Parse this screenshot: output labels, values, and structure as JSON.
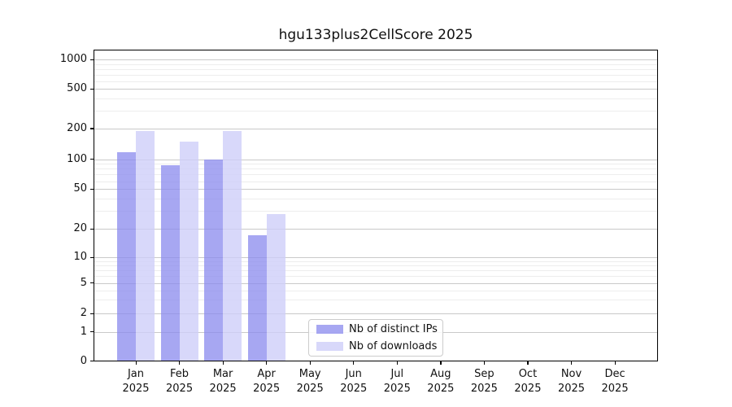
{
  "chart_data": {
    "type": "bar",
    "title": "hgu133plus2CellScore 2025",
    "categories": [
      "Jan 2025",
      "Feb 2025",
      "Mar 2025",
      "Apr 2025",
      "May 2025",
      "Jun 2025",
      "Jul 2025",
      "Aug 2025",
      "Sep 2025",
      "Oct 2025",
      "Nov 2025",
      "Dec 2025"
    ],
    "series": [
      {
        "name": "Nb of distinct IPs",
        "color": "rgba(137,137,238,0.75)",
        "color_on_white": "#a6a6f2",
        "values": [
          118,
          87,
          100,
          17,
          0,
          0,
          0,
          0,
          0,
          0,
          0,
          0
        ]
      },
      {
        "name": "Nb of downloads",
        "color": "rgba(206,206,249,0.8)",
        "color_on_white": "#d9d9f8",
        "values": [
          190,
          150,
          190,
          28,
          0,
          0,
          0,
          0,
          0,
          0,
          0,
          0
        ]
      }
    ],
    "yticks": [
      0,
      1,
      2,
      5,
      10,
      20,
      50,
      100,
      200,
      500,
      1000
    ],
    "yscale": "symlog",
    "ylim": [
      0,
      1260
    ],
    "xlabel": "",
    "ylabel": "",
    "grid": "horizontal major+minor, light gray",
    "legend": {
      "location": "inside lower center-left",
      "frame": true
    }
  }
}
